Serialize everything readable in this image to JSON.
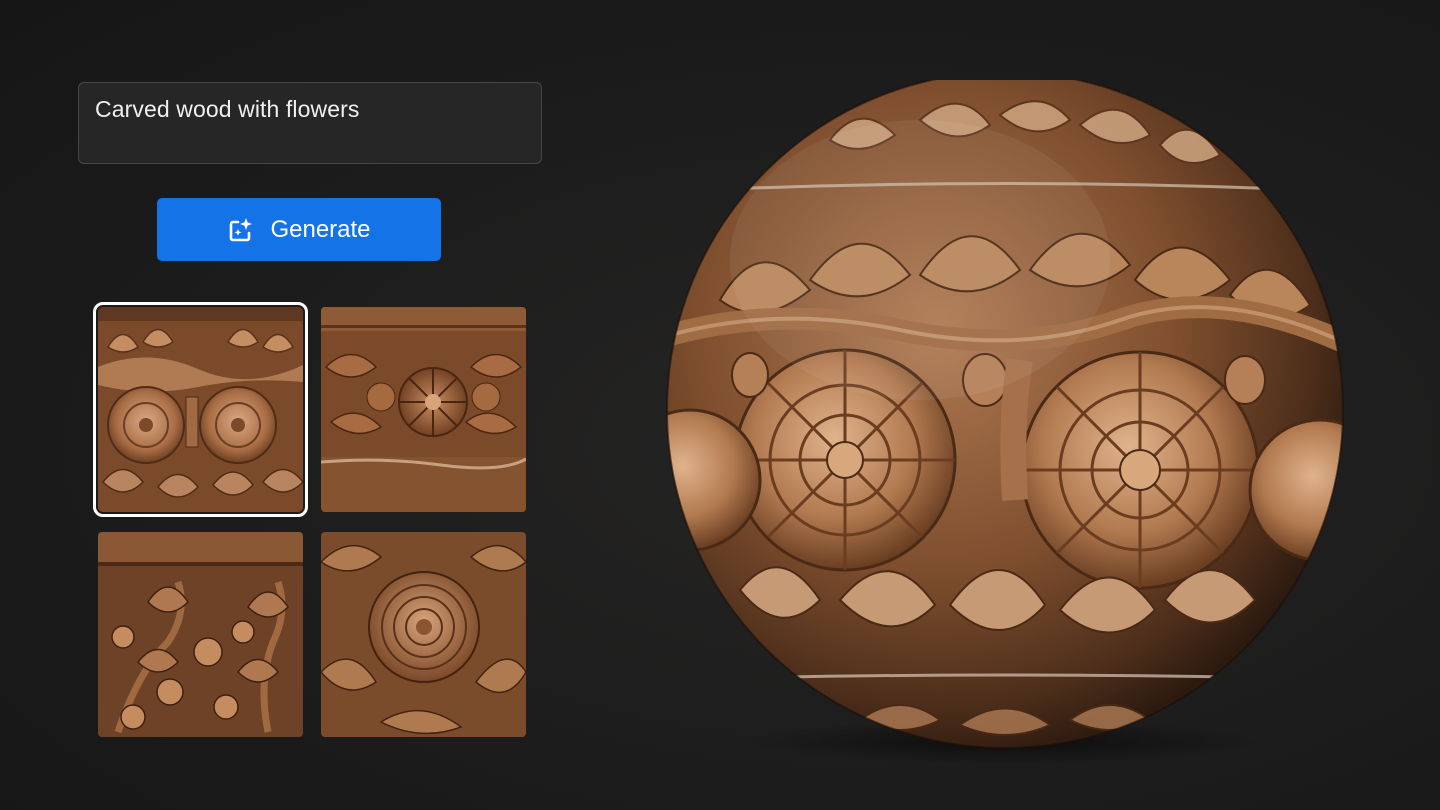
{
  "prompt": {
    "text": "Carved wood with flowers"
  },
  "generate_button": {
    "label": "Generate",
    "icon": "sparkle-image-icon",
    "color": "#1473e6"
  },
  "results": {
    "selected_index": 0,
    "thumbnails": [
      {
        "name": "result-thumbnail-1",
        "selected": true
      },
      {
        "name": "result-thumbnail-2",
        "selected": false
      },
      {
        "name": "result-thumbnail-3",
        "selected": false
      },
      {
        "name": "result-thumbnail-4",
        "selected": false
      }
    ]
  },
  "preview": {
    "material": "carved wood sphere"
  },
  "colors": {
    "background": "#1b1b1b",
    "wood_base": "#8a5a38",
    "wood_light": "#c99a72",
    "accent": "#1473e6"
  }
}
